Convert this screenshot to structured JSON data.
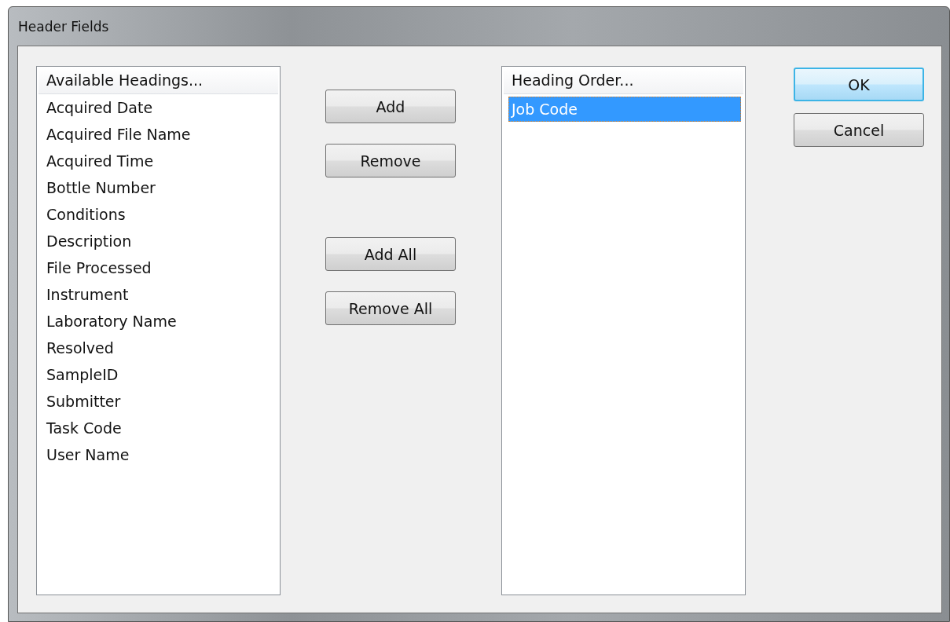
{
  "window": {
    "title": "Header Fields"
  },
  "available_list": {
    "header": "Available Headings...",
    "items": [
      {
        "label": "Acquired Date",
        "selected": false
      },
      {
        "label": "Acquired File Name",
        "selected": false
      },
      {
        "label": "Acquired Time",
        "selected": false
      },
      {
        "label": "Bottle Number",
        "selected": false
      },
      {
        "label": "Conditions",
        "selected": false
      },
      {
        "label": "Description",
        "selected": false
      },
      {
        "label": "File Processed",
        "selected": false
      },
      {
        "label": "Instrument",
        "selected": false
      },
      {
        "label": "Laboratory Name",
        "selected": false
      },
      {
        "label": "Resolved",
        "selected": false
      },
      {
        "label": "SampleID",
        "selected": false
      },
      {
        "label": "Submitter",
        "selected": false
      },
      {
        "label": "Task Code",
        "selected": false
      },
      {
        "label": "User Name",
        "selected": false
      }
    ]
  },
  "move_buttons": [
    {
      "label": "Add"
    },
    {
      "label": "Remove"
    }
  ],
  "move_all_buttons": [
    {
      "label": "Add All"
    },
    {
      "label": "Remove All"
    }
  ],
  "order_list": {
    "header": "Heading Order...",
    "items": [
      {
        "label": "Job Code",
        "selected": true
      }
    ]
  },
  "dialog_buttons": [
    {
      "label": "OK",
      "default": true
    },
    {
      "label": "Cancel",
      "default": false
    }
  ]
}
